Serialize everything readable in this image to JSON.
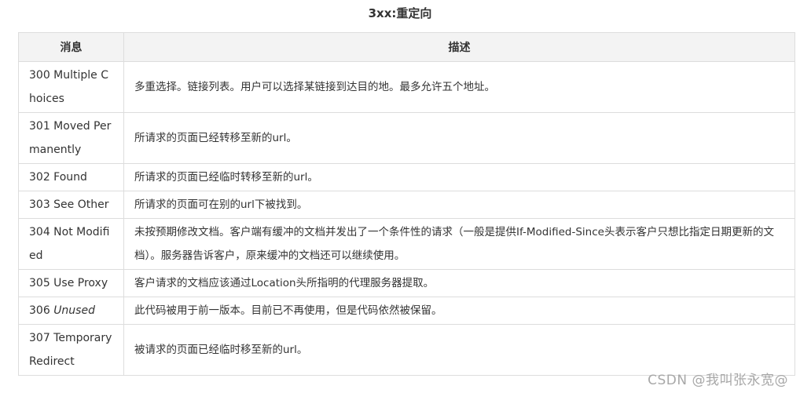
{
  "caption": "3xx:重定向",
  "headers": {
    "col1": "消息",
    "col2": "描述"
  },
  "rows": [
    {
      "code": "300 Multiple Choices",
      "desc": "多重选择。链接列表。用户可以选择某链接到达目的地。最多允许五个地址。"
    },
    {
      "code": "301 Moved Permanently",
      "desc": "所请求的页面已经转移至新的url。"
    },
    {
      "code": "302 Found",
      "desc": "所请求的页面已经临时转移至新的url。"
    },
    {
      "code": "303 See Other",
      "desc": "所请求的页面可在别的url下被找到。"
    },
    {
      "code": "304 Not Modified",
      "desc": "未按预期修改文档。客户端有缓冲的文档并发出了一个条件性的请求（一般是提供If-Modified-Since头表示客户只想比指定日期更新的文档）。服务器告诉客户，原来缓冲的文档还可以继续使用。"
    },
    {
      "code": "305 Use Proxy",
      "desc": "客户请求的文档应该通过Location头所指明的代理服务器提取。"
    },
    {
      "code_num": "306",
      "code_word": "Unused",
      "desc": "此代码被用于前一版本。目前已不再使用，但是代码依然被保留。"
    },
    {
      "code": "307 Temporary Redirect",
      "desc": "被请求的页面已经临时移至新的url。"
    }
  ],
  "watermark": "CSDN @我叫张永宽@"
}
